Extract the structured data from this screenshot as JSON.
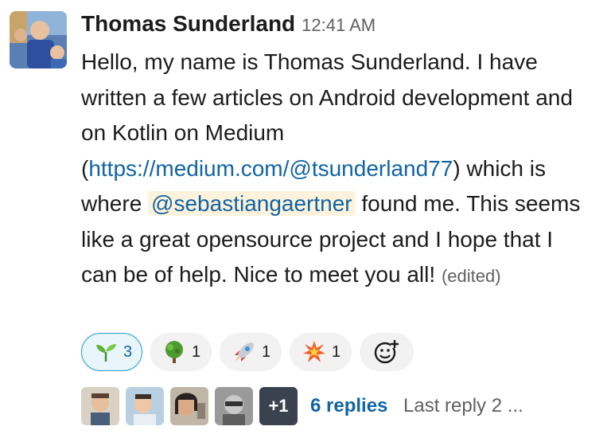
{
  "message": {
    "author": "Thomas Sunderland",
    "timestamp": "12:41 AM",
    "text_part1": "Hello, my name is Thomas Sunderland. I have written a few articles on Android development and on Kotlin on Medium (",
    "link": "https://medium.com/@tsunderland77",
    "text_part2": ") which is where ",
    "mention": "@sebastiangaertner",
    "text_part3": " found me. This seems like a great opensource project and I hope that I can be of help. Nice to meet you all!",
    "edited_label": "(edited)"
  },
  "reactions": [
    {
      "icon": "seedling-icon",
      "count": "3",
      "active": true
    },
    {
      "icon": "tree-icon",
      "count": "1",
      "active": false
    },
    {
      "icon": "rocket-icon",
      "count": "1",
      "active": false
    },
    {
      "icon": "collision-icon",
      "count": "1",
      "active": false
    }
  ],
  "add_reaction_icon": "add-reaction-icon",
  "thread": {
    "more_count": "+1",
    "replies": "6 replies",
    "last_reply": "Last reply 2 ..."
  },
  "colors": {
    "link": "#1264a3",
    "mention_bg": "#fdf3dc",
    "reaction_active_border": "#1d9bd1",
    "reaction_bg": "#f2f2f2"
  }
}
